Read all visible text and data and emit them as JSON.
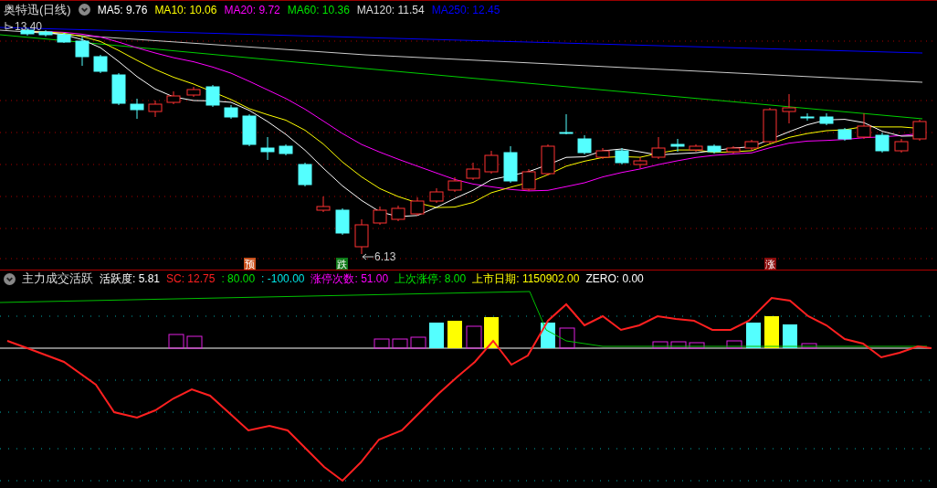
{
  "price_panel": {
    "title": "奥特迅(日线)",
    "indicators": [
      {
        "label": "MA5: 9.76",
        "color": "#ffffff"
      },
      {
        "label": "MA10: 10.06",
        "color": "#ffff00"
      },
      {
        "label": "MA20: 9.72",
        "color": "#ff00ff"
      },
      {
        "label": "MA60: 10.36",
        "color": "#00e600"
      },
      {
        "label": "MA120: 11.54",
        "color": "#dddddd"
      },
      {
        "label": "MA250: 12.45",
        "color": "#0000ff"
      }
    ],
    "high_label": "13.40",
    "low_label": "6.13",
    "markers": [
      {
        "text": "预",
        "color": "#c8501c"
      },
      {
        "text": "跌",
        "color": "#0e7a18"
      },
      {
        "text": "涨",
        "color": "#8a0c0c"
      }
    ]
  },
  "indicator_panel": {
    "title": "主力成交活跃",
    "values": [
      {
        "label": "活跃度: 5.81",
        "color": "#ffffff"
      },
      {
        "label": "SC: 12.75",
        "color": "#ff2020"
      },
      {
        "label": ": 80.00",
        "color": "#00e600"
      },
      {
        "label": ": -100.00",
        "color": "#00e6e6"
      },
      {
        "label": "涨停次数: 51.00",
        "color": "#ff00ff"
      },
      {
        "label": "上次涨停: 8.00",
        "color": "#00e600"
      },
      {
        "label": "上市日期: 1150902.00",
        "color": "#ffff00"
      },
      {
        "label": "ZERO: 0.00",
        "color": "#ffffff"
      }
    ]
  }
}
